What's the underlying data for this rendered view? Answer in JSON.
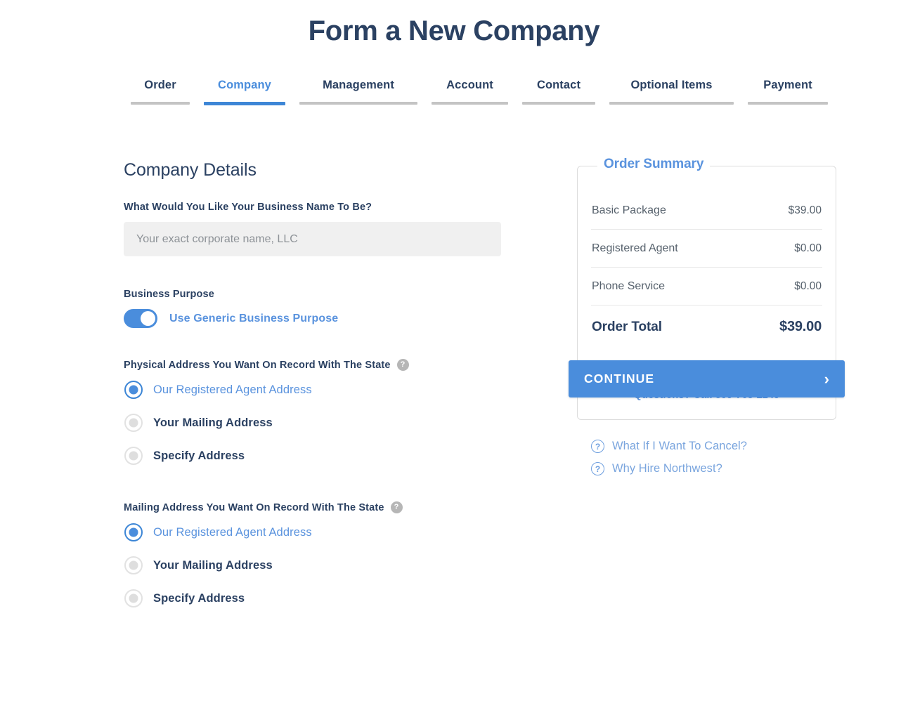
{
  "header": {
    "title": "Form a New Company"
  },
  "tabs": {
    "active_index": 1,
    "items": [
      {
        "label": "Order"
      },
      {
        "label": "Company"
      },
      {
        "label": "Management"
      },
      {
        "label": "Account"
      },
      {
        "label": "Contact"
      },
      {
        "label": "Optional Items"
      },
      {
        "label": "Payment"
      }
    ]
  },
  "company_details": {
    "section_title": "Company Details",
    "business_name": {
      "label": "What Would You Like Your Business Name To Be?",
      "value": "",
      "placeholder": "Your exact corporate name, LLC"
    },
    "business_purpose": {
      "label": "Business Purpose",
      "toggle_label": "Use Generic Business Purpose",
      "toggle_on": true
    },
    "physical_address": {
      "label": "Physical Address You Want On Record With The State",
      "help_icon": "question-mark-icon",
      "help_glyph": "?",
      "selected_index": 0,
      "options": [
        {
          "label": "Our Registered Agent Address"
        },
        {
          "label": "Your Mailing Address"
        },
        {
          "label": "Specify Address"
        }
      ]
    },
    "mailing_address": {
      "label": "Mailing Address You Want On Record With The State",
      "help_icon": "question-mark-icon",
      "help_glyph": "?",
      "selected_index": 0,
      "options": [
        {
          "label": "Our Registered Agent Address"
        },
        {
          "label": "Your Mailing Address"
        },
        {
          "label": "Specify Address"
        }
      ]
    }
  },
  "order_summary": {
    "legend": "Order Summary",
    "rows": [
      {
        "label": "Basic Package",
        "value": "$39.00"
      },
      {
        "label": "Registered Agent",
        "value": "$0.00"
      },
      {
        "label": "Phone Service",
        "value": "$0.00"
      }
    ],
    "total": {
      "label": "Order Total",
      "value": "$39.00"
    },
    "continue_button": {
      "label": "CONTINUE",
      "chevron": "›"
    },
    "questions": "Questions? Call 509-768-2249"
  },
  "help_links": {
    "glyph": "?",
    "items": [
      {
        "label": "What If I Want To Cancel?"
      },
      {
        "label": "Why Hire Northwest?"
      }
    ]
  },
  "colors": {
    "navy": "#2b4162",
    "accent_blue": "#4a8ddc",
    "light_blue": "#5a93de",
    "muted_gray": "#56616c",
    "input_bg": "#f0f0f0",
    "border_gray": "#dcdcdc",
    "tab_underline": "#c4c4c4"
  }
}
